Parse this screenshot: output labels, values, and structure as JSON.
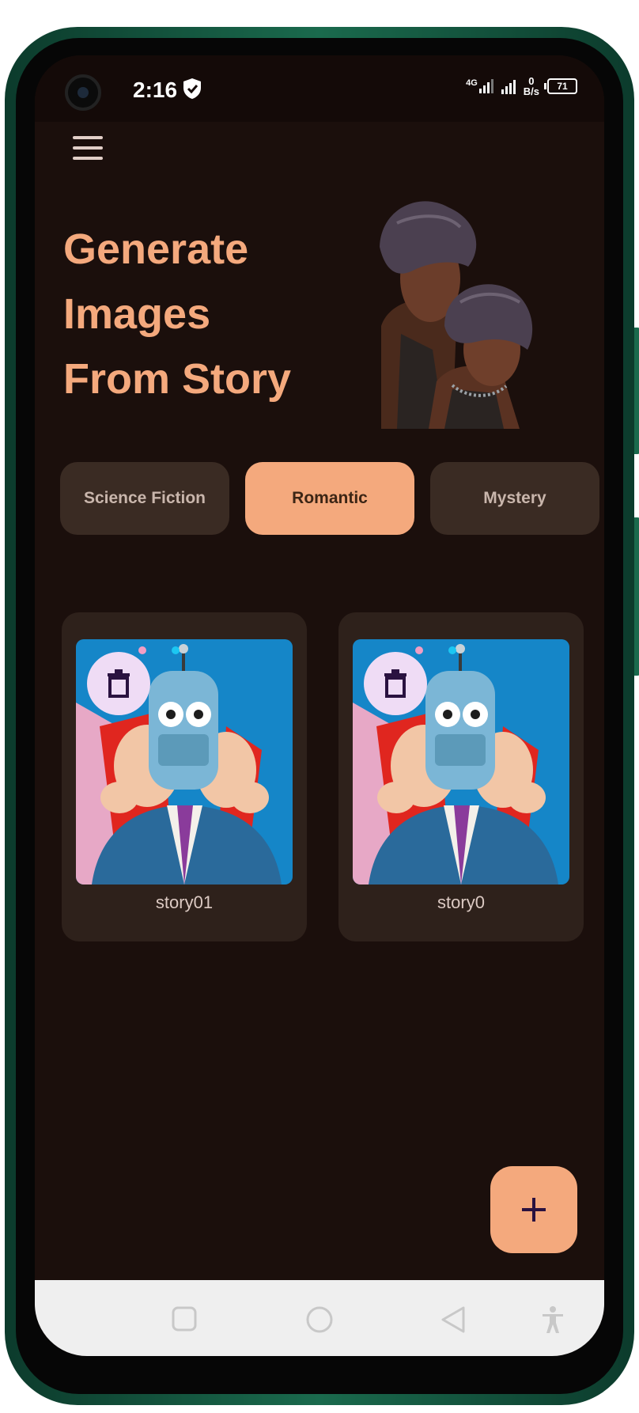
{
  "status_bar": {
    "time": "2:16",
    "network_label": "4G",
    "data_speed_value": "0",
    "data_speed_unit": "B/s",
    "battery": "71"
  },
  "hero": {
    "title_line1": "Generate",
    "title_line2": "Images",
    "title_line3": "From Story"
  },
  "categories": [
    {
      "label": "Science Fiction",
      "selected": false
    },
    {
      "label": "Romantic",
      "selected": true
    },
    {
      "label": "Mystery",
      "selected": false
    }
  ],
  "stories": [
    {
      "title": "story01"
    },
    {
      "title": "story0"
    }
  ],
  "icons": {
    "menu": "hamburger-menu-icon",
    "delete": "trash-icon",
    "add": "plus-icon",
    "nav_recents": "square-icon",
    "nav_home": "circle-icon",
    "nav_back": "triangle-back-icon",
    "nav_accessibility": "accessibility-icon"
  },
  "colors": {
    "background": "#1b0f0c",
    "accent": "#f4a97d",
    "chip_inactive": "#3a2b23",
    "card": "#2e211b",
    "delete_button": "#efdcf5"
  }
}
